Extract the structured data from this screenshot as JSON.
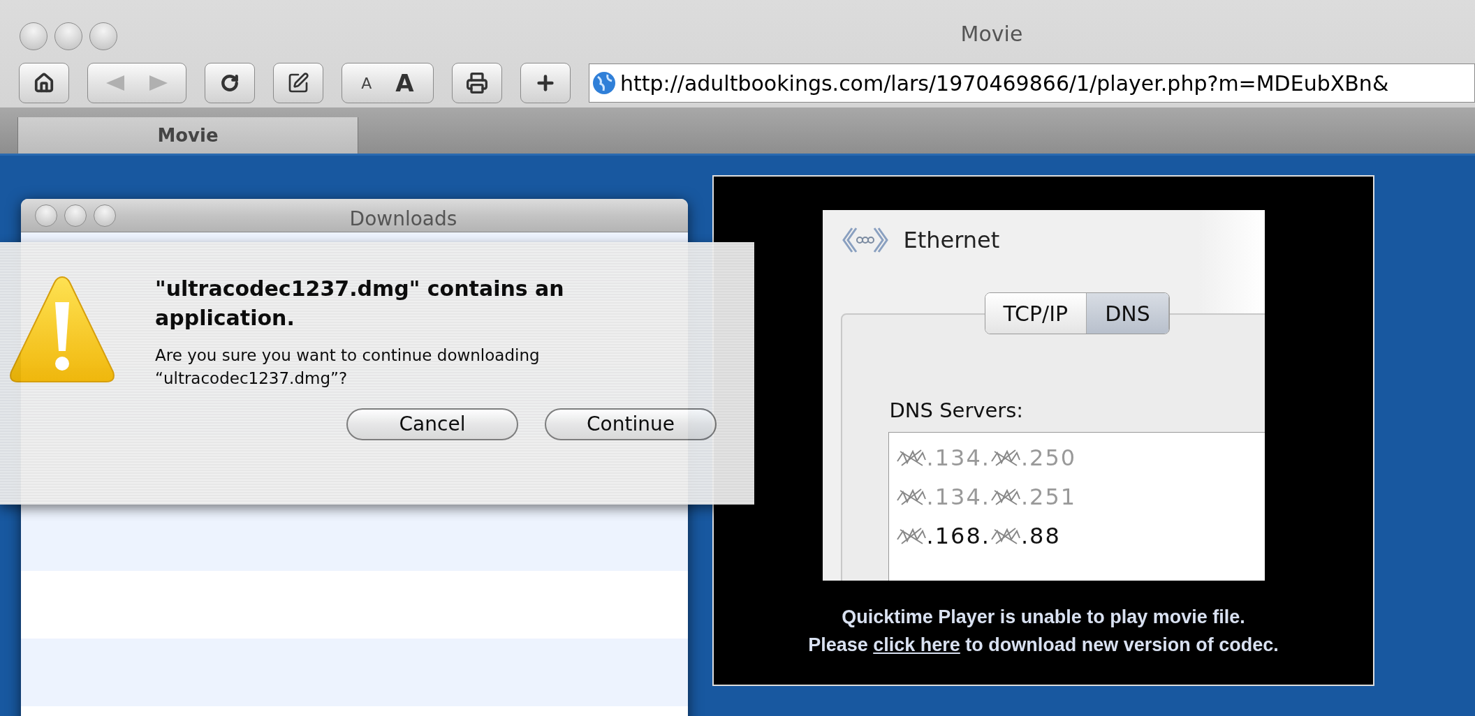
{
  "browser": {
    "title": "Movie",
    "toolbar": [
      {
        "kind": "home"
      },
      {
        "kind": "back_forward"
      },
      {
        "kind": "reload"
      },
      {
        "kind": "edit"
      },
      {
        "kind": "text_size",
        "labels": [
          "A",
          "A"
        ]
      },
      {
        "kind": "print"
      },
      {
        "kind": "add"
      }
    ],
    "address": "http://adultbookings.com/lars/1970469866/1/player.php?m=MDEubXBn&",
    "tabs": [
      {
        "label": "Movie",
        "selected": true
      }
    ]
  },
  "downloads_window": {
    "title": "Downloads"
  },
  "alert": {
    "title": "\"ultracodec1237.dmg\" contains an application.",
    "message": "Are you sure you want to continue downloading “ultracodec1237.dmg”?",
    "buttons": [
      "Cancel",
      "Continue"
    ]
  },
  "movie": {
    "screenshot": {
      "title": "Ethernet",
      "tabs": [
        {
          "label": "TCP/IP",
          "selected": false
        },
        {
          "label": "DNS",
          "selected": true
        }
      ],
      "dns_label": "DNS Servers:",
      "dns_servers": [
        {
          "parts": [
            ".134.",
            ".250"
          ],
          "dimmed": true
        },
        {
          "parts": [
            ".134.",
            ".251"
          ],
          "dimmed": true
        },
        {
          "parts": [
            ".168.",
            ".88"
          ],
          "dimmed": false
        }
      ]
    },
    "message": {
      "line_1": "Quicktime Player is unable to play movie file.",
      "before_link": "Please ",
      "link": "click here",
      "after_link": " to download new version of codec."
    }
  }
}
